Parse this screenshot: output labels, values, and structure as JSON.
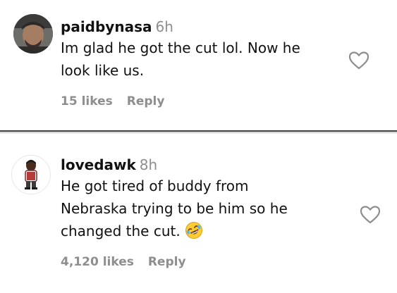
{
  "comments": [
    {
      "username": "paidbynasa",
      "timestamp": "6h",
      "text_lines": [
        "Im glad he got the cut lol. Now he",
        "look like us."
      ],
      "likes": "15 likes",
      "reply": "Reply",
      "avatar_icon": "user-avatar-photo",
      "like_icon": "heart-outline-icon"
    },
    {
      "username": "lovedawk",
      "timestamp": "8h",
      "text_lines": [
        "He got tired of buddy from",
        "Nebraska trying to be him so he",
        "changed the cut."
      ],
      "emoji": "rolling-on-floor-laughing-emoji",
      "likes": "4,120 likes",
      "reply": "Reply",
      "avatar_icon": "user-avatar-cartoon",
      "like_icon": "heart-outline-icon"
    }
  ],
  "colors": {
    "username": "#111111",
    "secondary_text": "#8e8e8e",
    "divider": "#3a3a3a",
    "background": "#ffffff"
  }
}
